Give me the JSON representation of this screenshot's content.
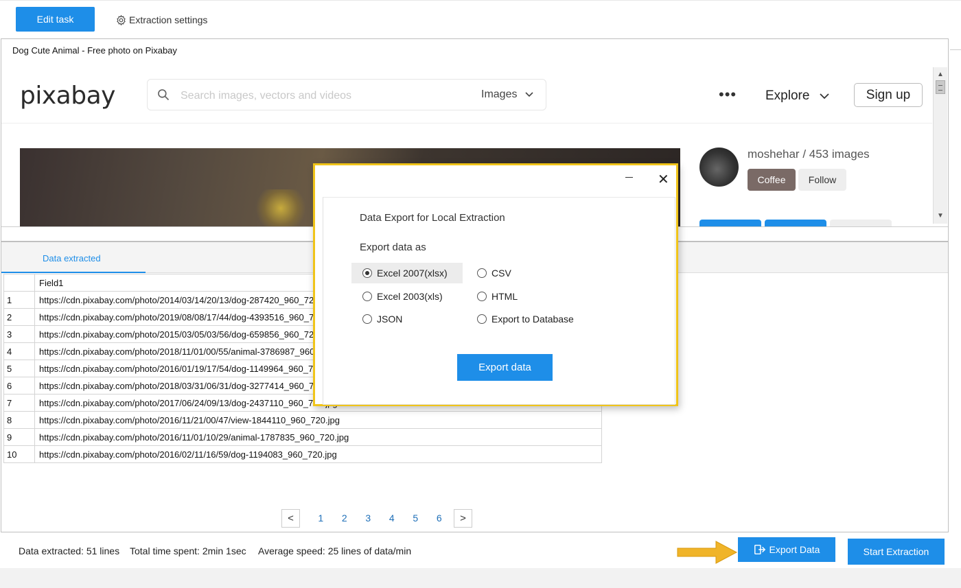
{
  "toolbar": {
    "edit_task_label": "Edit task",
    "settings_label": "Extraction settings",
    "settings_icon": "gear-icon"
  },
  "browser": {
    "tab_title": "Dog Cute Animal - Free photo on Pixabay",
    "logo": "pixabay",
    "search_placeholder": "Search images, vectors and videos",
    "search_category": "Images",
    "more_label": "•••",
    "explore_label": "Explore",
    "signup_label": "Sign up",
    "user_label": "moshehar / 453 images",
    "coffee_label": "Coffee",
    "follow_label": "Follow"
  },
  "data_panel": {
    "tab_label": "Data extracted",
    "column_header": "Field1",
    "rows": [
      {
        "idx": "1",
        "value": "https://cdn.pixabay.com/photo/2014/03/14/20/13/dog-287420_960_720.jpg"
      },
      {
        "idx": "2",
        "value": "https://cdn.pixabay.com/photo/2019/08/08/17/44/dog-4393516_960_720.jpg"
      },
      {
        "idx": "3",
        "value": "https://cdn.pixabay.com/photo/2015/03/05/03/56/dog-659856_960_720.jpg"
      },
      {
        "idx": "4",
        "value": "https://cdn.pixabay.com/photo/2018/11/01/00/55/animal-3786987_960_720.jpg"
      },
      {
        "idx": "5",
        "value": "https://cdn.pixabay.com/photo/2016/01/19/17/54/dog-1149964_960_720.jpg"
      },
      {
        "idx": "6",
        "value": "https://cdn.pixabay.com/photo/2018/03/31/06/31/dog-3277414_960_720.jpg"
      },
      {
        "idx": "7",
        "value": "https://cdn.pixabay.com/photo/2017/06/24/09/13/dog-2437110_960_720.jpg"
      },
      {
        "idx": "8",
        "value": "https://cdn.pixabay.com/photo/2016/11/21/00/47/view-1844110_960_720.jpg"
      },
      {
        "idx": "9",
        "value": "https://cdn.pixabay.com/photo/2016/11/01/10/29/animal-1787835_960_720.jpg"
      },
      {
        "idx": "10",
        "value": "https://cdn.pixabay.com/photo/2016/02/11/16/59/dog-1194083_960_720.jpg"
      }
    ],
    "pages": [
      "1",
      "2",
      "3",
      "4",
      "5",
      "6"
    ],
    "prev_label": "<",
    "next_label": ">"
  },
  "status": {
    "lines": "Data extracted: 51 lines",
    "time": "Total time spent: 2min 1sec",
    "speed": "Average speed: 25 lines of data/min",
    "export_label": "Export Data",
    "start_label": "Start Extraction"
  },
  "modal": {
    "title": "Data Export for Local Extraction",
    "subtitle": "Export data as",
    "options": [
      {
        "label": "Excel 2007(xlsx)",
        "selected": true
      },
      {
        "label": "CSV",
        "selected": false
      },
      {
        "label": "Excel 2003(xls)",
        "selected": false
      },
      {
        "label": "HTML",
        "selected": false
      },
      {
        "label": "JSON",
        "selected": false
      },
      {
        "label": "Export to Database",
        "selected": false
      }
    ],
    "export_button": "Export data",
    "close_label": "✕"
  },
  "colors": {
    "accent": "#1e8ee8",
    "highlight_border": "#f0c419",
    "annotation_arrow": "#f0b429"
  }
}
